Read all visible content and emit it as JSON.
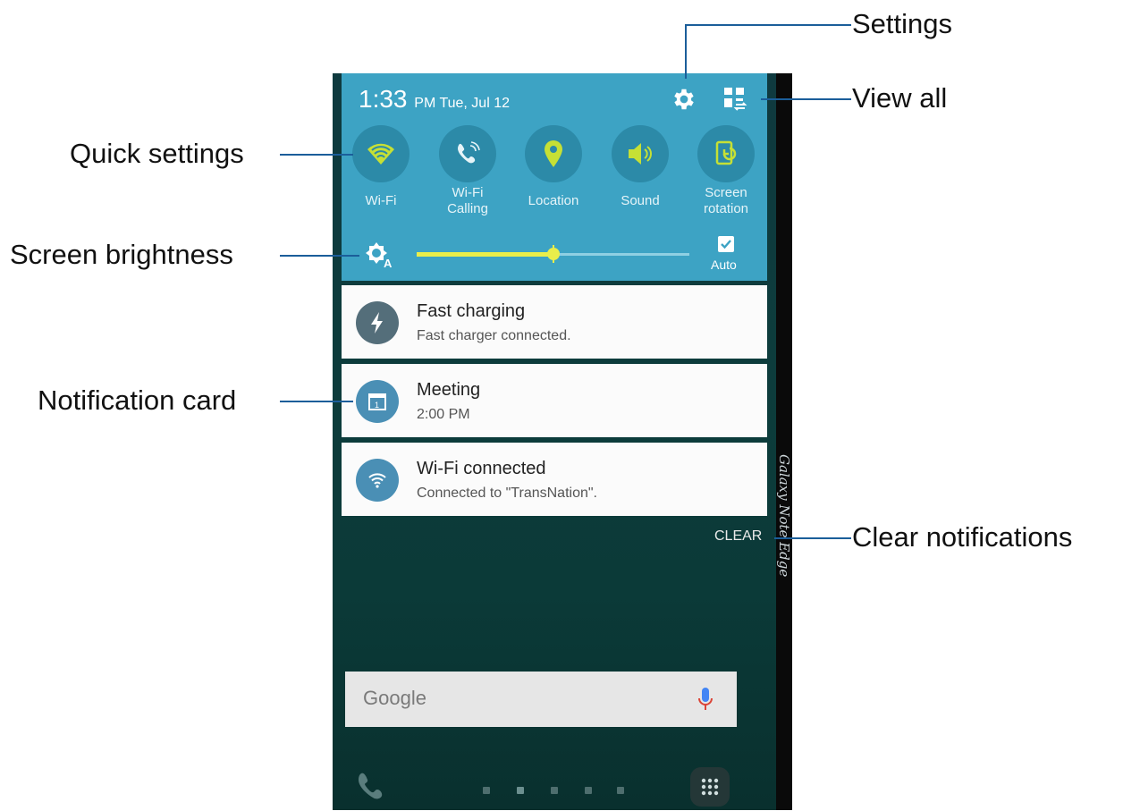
{
  "callouts": {
    "settings": "Settings",
    "view_all": "View all",
    "quick_settings": "Quick settings",
    "screen_brightness": "Screen brightness",
    "notification_card": "Notification card",
    "clear_notifications": "Clear notifications"
  },
  "status": {
    "time": "1:33",
    "meridiem_date": "PM Tue, Jul 12"
  },
  "quick_settings": [
    {
      "label": "Wi-Fi",
      "icon": "wifi-icon"
    },
    {
      "label": "Wi-Fi\nCalling",
      "icon": "wifi-calling-icon"
    },
    {
      "label": "Location",
      "icon": "location-icon"
    },
    {
      "label": "Sound",
      "icon": "sound-icon"
    },
    {
      "label": "Screen\nrotation",
      "icon": "screen-rotation-icon"
    }
  ],
  "brightness": {
    "level": 0.5,
    "auto_label": "Auto",
    "auto_checked": true
  },
  "notifications": [
    {
      "title": "Fast charging",
      "subtitle": "Fast charger connected.",
      "icon": "bolt-icon"
    },
    {
      "title": "Meeting",
      "subtitle": "2:00 PM",
      "icon": "calendar-icon"
    },
    {
      "title": "Wi-Fi connected",
      "subtitle": "Connected to \"TransNation\".",
      "icon": "wifi-icon"
    }
  ],
  "clear_label": "CLEAR",
  "google": {
    "logo": "Google"
  },
  "edge_label": "Galaxy Note Edge",
  "colors": {
    "panel": "#3da3c4",
    "accent_green": "#c6e035",
    "slider": "#e9ee4a",
    "callout_line": "#1b5e9a"
  }
}
